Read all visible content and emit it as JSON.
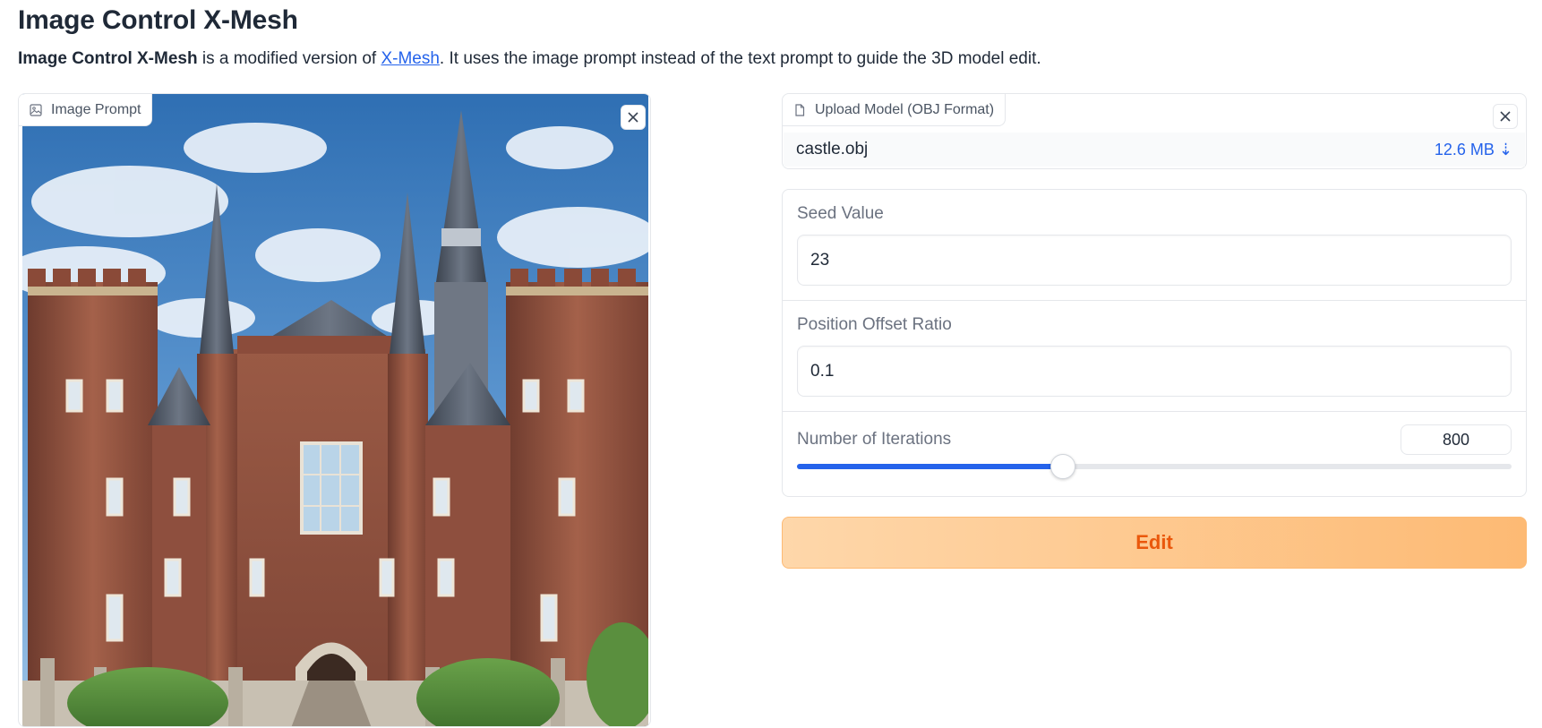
{
  "header": {
    "title": "Image Control X-Mesh",
    "desc_bold": "Image Control X-Mesh",
    "desc_part1": " is a modified version of ",
    "desc_link": "X-Mesh",
    "desc_part2": ". It uses the image prompt instead of the text prompt to guide the 3D model edit."
  },
  "image_prompt": {
    "label": "Image Prompt",
    "icon": "image-icon"
  },
  "upload_model": {
    "label": "Upload Model (OBJ Format)",
    "icon": "file-icon",
    "file_name": "castle.obj",
    "file_size": "12.6 MB ⇣"
  },
  "seed": {
    "label": "Seed Value",
    "value": "23"
  },
  "offset": {
    "label": "Position Offset Ratio",
    "value": "0.1"
  },
  "iterations": {
    "label": "Number of Iterations",
    "value": "800",
    "fraction": 0.372
  },
  "edit_button": {
    "label": "Edit"
  },
  "colors": {
    "accent": "#2563eb",
    "button_text": "#ea580c",
    "button_bg_start": "#fed7aa",
    "button_bg_end": "#fdba74"
  }
}
